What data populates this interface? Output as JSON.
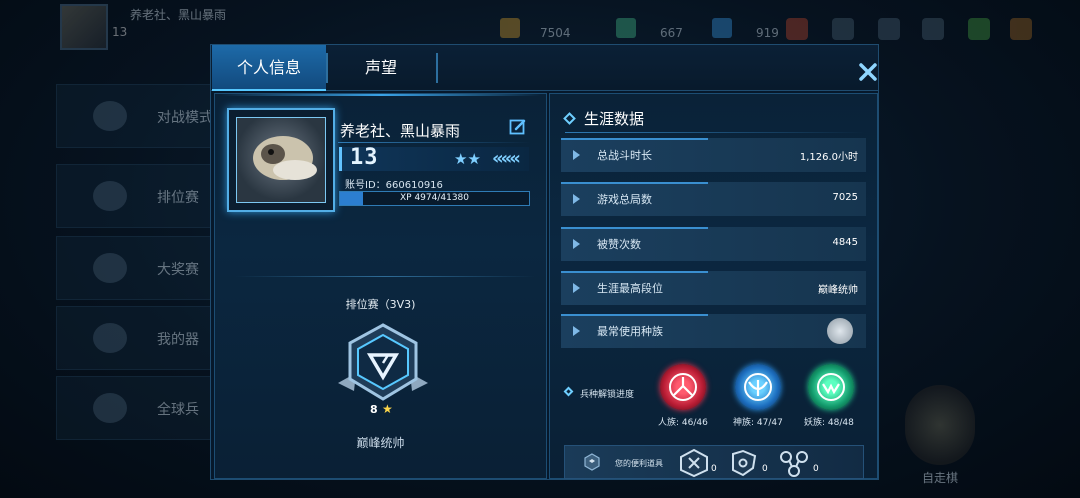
{
  "background": {
    "player_name": "养老社、黑山暴雨",
    "level": "13",
    "resources": [
      "7504",
      "667",
      "919"
    ],
    "menu": [
      "对战模式",
      "排位赛",
      "大奖赛",
      "我的器",
      "全球兵"
    ],
    "right_label": "自走棋"
  },
  "tabs": [
    {
      "label": "个人信息",
      "active": true
    },
    {
      "label": "声望",
      "active": false
    }
  ],
  "profile": {
    "name": "养老社、黑山暴雨",
    "level": "13",
    "stars": "★★",
    "chevrons": "«««",
    "account_id": "账号ID：660610916",
    "xp_text": "XP 4974/41380",
    "xp_current": 4974,
    "xp_total": 41380
  },
  "rank": {
    "title": "排位赛（3V3)",
    "stars": "8",
    "name": "巅峰统帅"
  },
  "career": {
    "title": "生涯数据",
    "stats": [
      {
        "label": "总战斗时长",
        "value": "1,126.0小时"
      },
      {
        "label": "游戏总局数",
        "value": "7025"
      },
      {
        "label": "被赞次数",
        "value": "4845"
      },
      {
        "label": "生涯最高段位",
        "value": "巅峰统帅"
      },
      {
        "label": "最常使用种族",
        "value": ""
      }
    ]
  },
  "unlock": {
    "title": "兵种解锁进度",
    "races": [
      {
        "label": "人族: 46/46",
        "color": "#e0304a"
      },
      {
        "label": "神族: 47/47",
        "color": "#2a8fe0"
      },
      {
        "label": "妖族: 48/48",
        "color": "#1fbf8a"
      }
    ]
  },
  "items": {
    "label": "您的便利道具",
    "counts": [
      "0",
      "0",
      "0"
    ]
  },
  "colors": {
    "accent": "#57c8ff",
    "panel": "#0b2740",
    "tab_active": "#1d6aa8"
  }
}
